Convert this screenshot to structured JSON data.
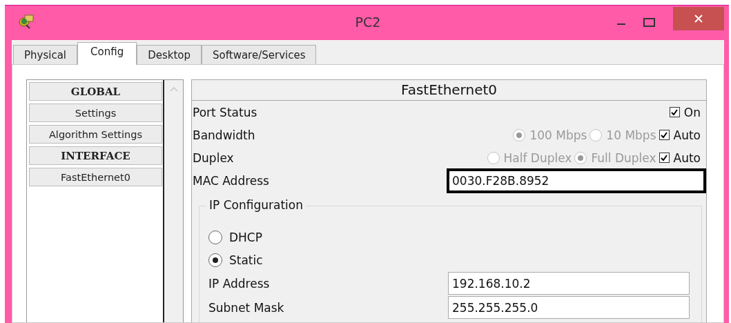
{
  "window": {
    "title": "PC2"
  },
  "tabs": [
    {
      "label": "Physical",
      "selected": false
    },
    {
      "label": "Config",
      "selected": true
    },
    {
      "label": "Desktop",
      "selected": false
    },
    {
      "label": "Software/Services",
      "selected": false
    }
  ],
  "sidebar": {
    "items": [
      {
        "label": "GLOBAL",
        "kind": "header"
      },
      {
        "label": "Settings",
        "kind": "item"
      },
      {
        "label": "Algorithm Settings",
        "kind": "item"
      },
      {
        "label": "INTERFACE",
        "kind": "header"
      },
      {
        "label": "FastEthernet0",
        "kind": "item"
      }
    ]
  },
  "interface": {
    "title": "FastEthernet0",
    "rows": [
      {
        "label": "Port Status",
        "radios": [],
        "checkbox": {
          "label": "On",
          "checked": true
        }
      },
      {
        "label": "Bandwidth",
        "disabled": true,
        "radios": [
          {
            "label": "100 Mbps",
            "selected": true
          },
          {
            "label": "10 Mbps",
            "selected": false
          }
        ],
        "checkbox": {
          "label": "Auto",
          "checked": true
        }
      },
      {
        "label": "Duplex",
        "disabled": true,
        "radios": [
          {
            "label": "Half Duplex",
            "selected": false
          },
          {
            "label": "Full Duplex",
            "selected": true
          }
        ],
        "checkbox": {
          "label": "Auto",
          "checked": true
        }
      }
    ],
    "mac": {
      "label": "MAC Address",
      "value": "0030.F28B.8952",
      "focused": true
    },
    "ip_config": {
      "title": "IP Configuration",
      "modes": [
        {
          "label": "DHCP",
          "selected": false
        },
        {
          "label": "Static",
          "selected": true
        }
      ],
      "fields": [
        {
          "label": "IP Address",
          "value": "192.168.10.2"
        },
        {
          "label": "Subnet Mask",
          "value": "255.255.255.0"
        }
      ]
    }
  }
}
